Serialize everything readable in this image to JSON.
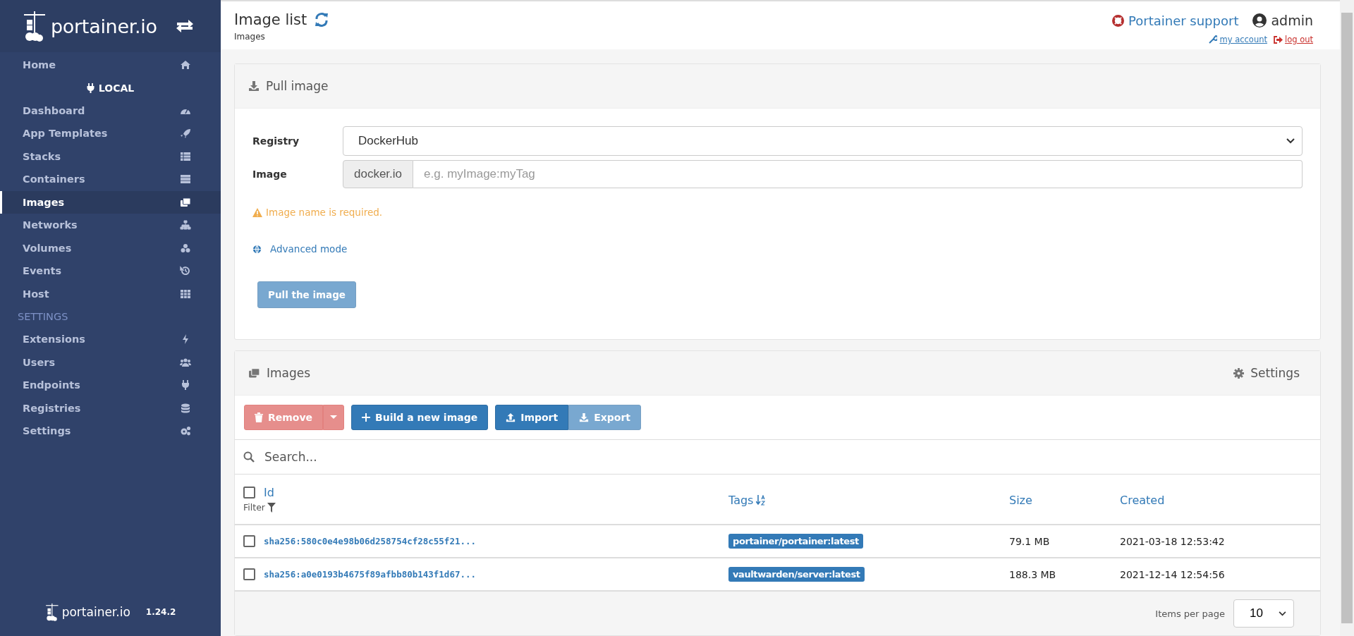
{
  "sidebar": {
    "brand": "portainer.io",
    "items": [
      {
        "kind": "link",
        "label": "Home",
        "selected": false
      },
      {
        "kind": "endpoint",
        "label": "LOCAL"
      },
      {
        "kind": "link",
        "label": "Dashboard",
        "selected": false
      },
      {
        "kind": "link",
        "label": "App Templates",
        "selected": false
      },
      {
        "kind": "link",
        "label": "Stacks",
        "selected": false
      },
      {
        "kind": "link",
        "label": "Containers",
        "selected": false
      },
      {
        "kind": "link",
        "label": "Images",
        "selected": true
      },
      {
        "kind": "link",
        "label": "Networks",
        "selected": false
      },
      {
        "kind": "link",
        "label": "Volumes",
        "selected": false
      },
      {
        "kind": "link",
        "label": "Events",
        "selected": false
      },
      {
        "kind": "link",
        "label": "Host",
        "selected": false
      },
      {
        "kind": "heading",
        "label": "SETTINGS"
      },
      {
        "kind": "link",
        "label": "Extensions",
        "selected": false
      },
      {
        "kind": "link",
        "label": "Users",
        "selected": false
      },
      {
        "kind": "link",
        "label": "Endpoints",
        "selected": false
      },
      {
        "kind": "link",
        "label": "Registries",
        "selected": false
      },
      {
        "kind": "link",
        "label": "Settings",
        "selected": false
      }
    ],
    "footer": {
      "brand": "portainer.io",
      "version": "1.24.2"
    }
  },
  "header": {
    "title": "Image list",
    "breadcrumb": "Images",
    "support": "Portainer support",
    "user": "admin",
    "my_account": "my account",
    "log_out": "log out"
  },
  "pull_panel": {
    "title": "Pull image",
    "registry_label": "Registry",
    "registry_value": "DockerHub",
    "image_label": "Image",
    "image_prefix": "docker.io",
    "image_placeholder": "e.g. myImage:myTag",
    "warning": "Image name is required.",
    "advanced_link": "Advanced mode",
    "pull_button": {
      "label": "Pull the image",
      "disabled": true
    }
  },
  "images_panel": {
    "title": "Images",
    "settings": "Settings",
    "toolbar": [
      {
        "kind": "danger",
        "label": "Remove",
        "disabled": true
      },
      {
        "kind": "primary",
        "label": "Build a new image",
        "disabled": false
      },
      {
        "kind": "import",
        "label": "Import",
        "disabled": false
      },
      {
        "kind": "export",
        "label": "Export",
        "disabled": true
      }
    ],
    "search": {
      "placeholder": "Search..."
    },
    "columns": [
      "Id",
      "Tags",
      "Size",
      "Created"
    ],
    "filter": "Filter",
    "select_all": {
      "checked": false
    },
    "rows": [
      {
        "checked": false,
        "id": "sha256:580c0e4e98b06d258754cf28c55f21...",
        "tag": "portainer/portainer:latest",
        "size": "79.1 MB",
        "created": "2021-03-18 12:53:42"
      },
      {
        "checked": false,
        "id": "sha256:a0e0193b4675f89afbb80b143f1d67...",
        "tag": "vaultwarden/server:latest",
        "size": "188.3 MB",
        "created": "2021-12-14 12:54:56"
      }
    ],
    "items_per_page_label": "Items per page",
    "items_per_page": "10"
  }
}
